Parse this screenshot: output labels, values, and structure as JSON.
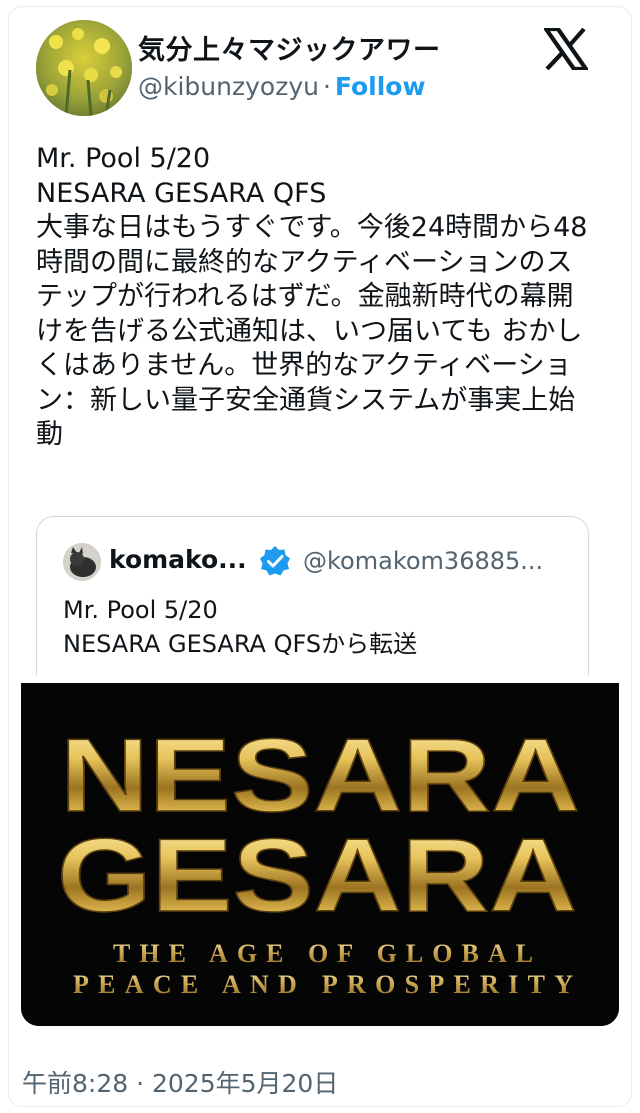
{
  "post": {
    "display_name": "気分上々マジックアワー",
    "handle": "@kibunzyozyu",
    "separator": "·",
    "follow_label": "Follow",
    "logo_icon": "x-logo-icon",
    "body_text": "Mr. Pool   5/20\nNESARA GESARA QFS\n大事な日はもうすぐです。今後24時間から48時間の間に最終的なアクティベーションのステップが行われるはずだ。金融新時代の幕開けを告げる公式通知は、いつ届いても おかしくはありません。世界的なアクティベーション：新しい量子安全通貨システムが事実上始動",
    "timestamp": "午前8:28 · 2025年5月20日"
  },
  "quote": {
    "name": "komako...",
    "verified_icon": "verified-badge-icon",
    "handle": "@komakom36885...",
    "text": "Mr. Pool   5/20\nNESARA GESARA QFSから転送"
  },
  "banner": {
    "line1": "NESARA",
    "line2": "GESARA",
    "tagline1": "THE AGE OF GLOBAL",
    "tagline2": "PEACE AND PROSPERITY"
  },
  "colors": {
    "link": "#1d9bf0",
    "secondary_text": "#536471",
    "gold": "#d8b64a"
  }
}
